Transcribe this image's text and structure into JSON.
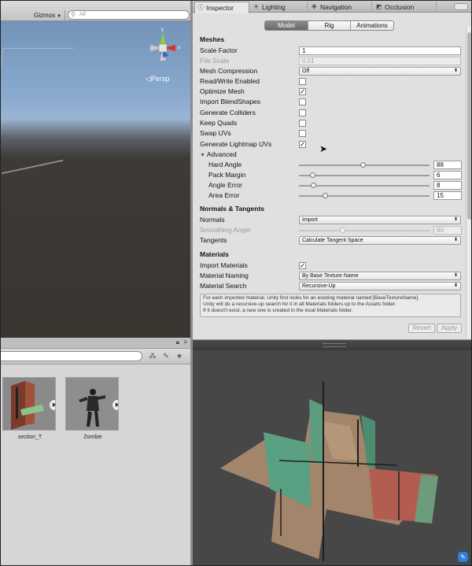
{
  "scene": {
    "gizmos_label": "Gizmos",
    "search_placeholder": "All",
    "persp_label": "Persp",
    "axis_labels": {
      "y": "y",
      "x": "x"
    }
  },
  "inspector": {
    "tabs": [
      {
        "label": "Inspector",
        "icon": "info-icon",
        "active": true
      },
      {
        "label": "Lighting",
        "icon": "lightbulb-icon",
        "active": false
      },
      {
        "label": "Navigation",
        "icon": "navigation-icon",
        "active": false
      },
      {
        "label": "Occlusion",
        "icon": "occlusion-icon",
        "active": false
      }
    ],
    "mode_tabs": [
      "Model",
      "Rig",
      "Animations"
    ],
    "active_mode": "Model",
    "meshes": {
      "title": "Meshes",
      "scale_factor_label": "Scale Factor",
      "scale_factor_value": "1",
      "file_scale_label": "File Scale",
      "file_scale_value": "0.01",
      "mesh_compression_label": "Mesh Compression",
      "mesh_compression_value": "Off",
      "read_write_label": "Read/Write Enabled",
      "read_write_checked": false,
      "optimize_mesh_label": "Optimize Mesh",
      "optimize_mesh_checked": true,
      "import_blendshapes_label": "Import BlendShapes",
      "import_blendshapes_checked": false,
      "generate_colliders_label": "Generate Colliders",
      "generate_colliders_checked": false,
      "keep_quads_label": "Keep Quads",
      "keep_quads_checked": false,
      "swap_uvs_label": "Swap UVs",
      "swap_uvs_checked": false,
      "lightmap_uvs_label": "Generate Lightmap UVs",
      "lightmap_uvs_checked": true,
      "advanced_label": "Advanced",
      "hard_angle_label": "Hard Angle",
      "hard_angle_value": "88",
      "hard_angle_fraction": 0.49,
      "pack_margin_label": "Pack Margin",
      "pack_margin_value": "6",
      "pack_margin_fraction": 0.1,
      "angle_error_label": "Angle Error",
      "angle_error_value": "8",
      "angle_error_fraction": 0.11,
      "area_error_label": "Area Error",
      "area_error_value": "15",
      "area_error_fraction": 0.2
    },
    "normals": {
      "title": "Normals & Tangents",
      "normals_label": "Normals",
      "normals_value": "Import",
      "smoothing_label": "Smoothing Angle",
      "smoothing_value": "60",
      "smoothing_fraction": 0.33,
      "tangents_label": "Tangents",
      "tangents_value": "Calculate Tangent Space"
    },
    "materials": {
      "title": "Materials",
      "import_label": "Import Materials",
      "import_checked": true,
      "naming_label": "Material Naming",
      "naming_value": "By Base Texture Name",
      "search_label": "Material Search",
      "search_value": "Recursive-Up",
      "help_line1": "For each imported material, Unity first looks for an existing material named [BaseTextureName].",
      "help_line2": "Unity will do a recursive-up search for it in all Materials folders up to the Assets folder.",
      "help_line3": "If it doesn't exist, a new one is created in the local Materials folder."
    },
    "revert_label": "Revert",
    "apply_label": "Apply"
  },
  "project": {
    "assets": [
      {
        "name": "section_T"
      },
      {
        "name": "Zombie"
      }
    ]
  },
  "colors": {
    "accent_blue": "#2f7fd9",
    "preview_bg": "#474747",
    "panel_bg": "#e0e0e0"
  }
}
